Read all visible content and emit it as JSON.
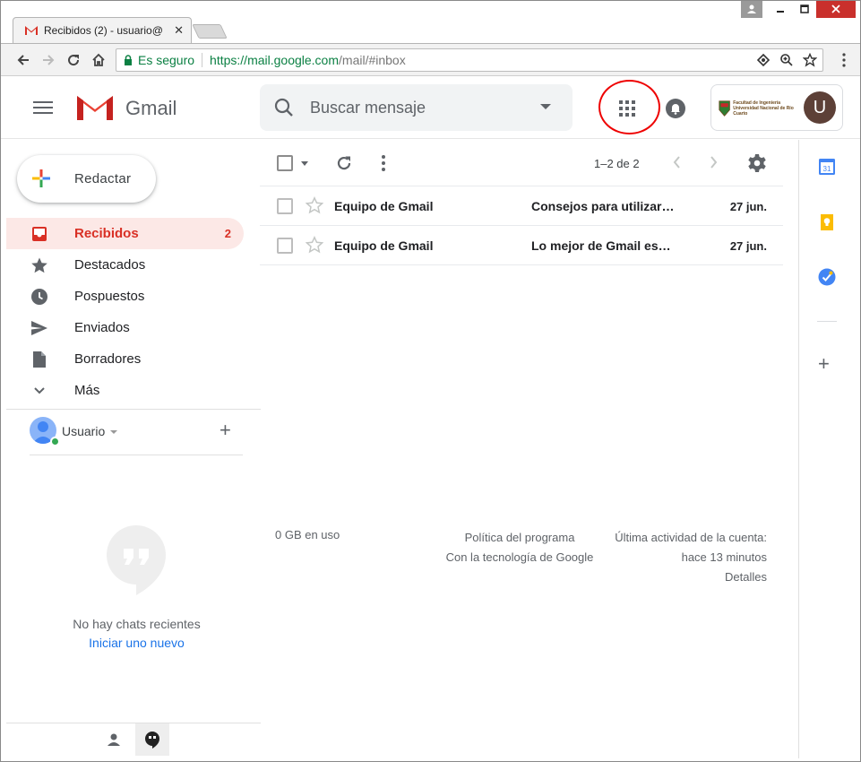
{
  "browser": {
    "tab_title": "Recibidos (2) - usuario@",
    "secure_label": "Es seguro",
    "url_scheme_host": "https://mail.google.com",
    "url_path": "/mail/#inbox"
  },
  "header": {
    "app_name": "Gmail",
    "search_placeholder": "Buscar mensaje",
    "org_logo_text": "Facultad de Ingeniería",
    "org_logo_subtext": "Universidad Nacional de Río Cuarto",
    "avatar_letter": "U"
  },
  "sidebar": {
    "compose_label": "Redactar",
    "items": [
      {
        "label": "Recibidos",
        "count": "2",
        "icon": "inbox-icon"
      },
      {
        "label": "Destacados",
        "count": "",
        "icon": "star-icon"
      },
      {
        "label": "Pospuestos",
        "count": "",
        "icon": "clock-icon"
      },
      {
        "label": "Enviados",
        "count": "",
        "icon": "send-icon"
      },
      {
        "label": "Borradores",
        "count": "",
        "icon": "draft-icon"
      },
      {
        "label": "Más",
        "count": "",
        "icon": "chevron-down-icon"
      }
    ],
    "user_name": "Usuario",
    "no_chats": "No hay chats recientes",
    "start_new": "Iniciar uno nuevo"
  },
  "list": {
    "pager": "1–2 de 2",
    "rows": [
      {
        "sender": "Equipo de Gmail",
        "subject": "Consejos para utilizar…",
        "date": "27 jun."
      },
      {
        "sender": "Equipo de Gmail",
        "subject": "Lo mejor de Gmail es…",
        "date": "27 jun."
      }
    ]
  },
  "footer": {
    "storage": "0 GB en uso",
    "policy": "Política del programa",
    "powered": "Con la tecnología de Google",
    "last_activity": "Última actividad de la cuenta:",
    "last_activity_time": "hace 13 minutos",
    "details": "Detalles"
  },
  "side_panel": {
    "calendar_day": "31"
  },
  "colors": {
    "accent_red": "#d93025",
    "active_bg": "#fce8e6",
    "link_blue": "#1a73e8",
    "secure_green": "#0b8043"
  }
}
